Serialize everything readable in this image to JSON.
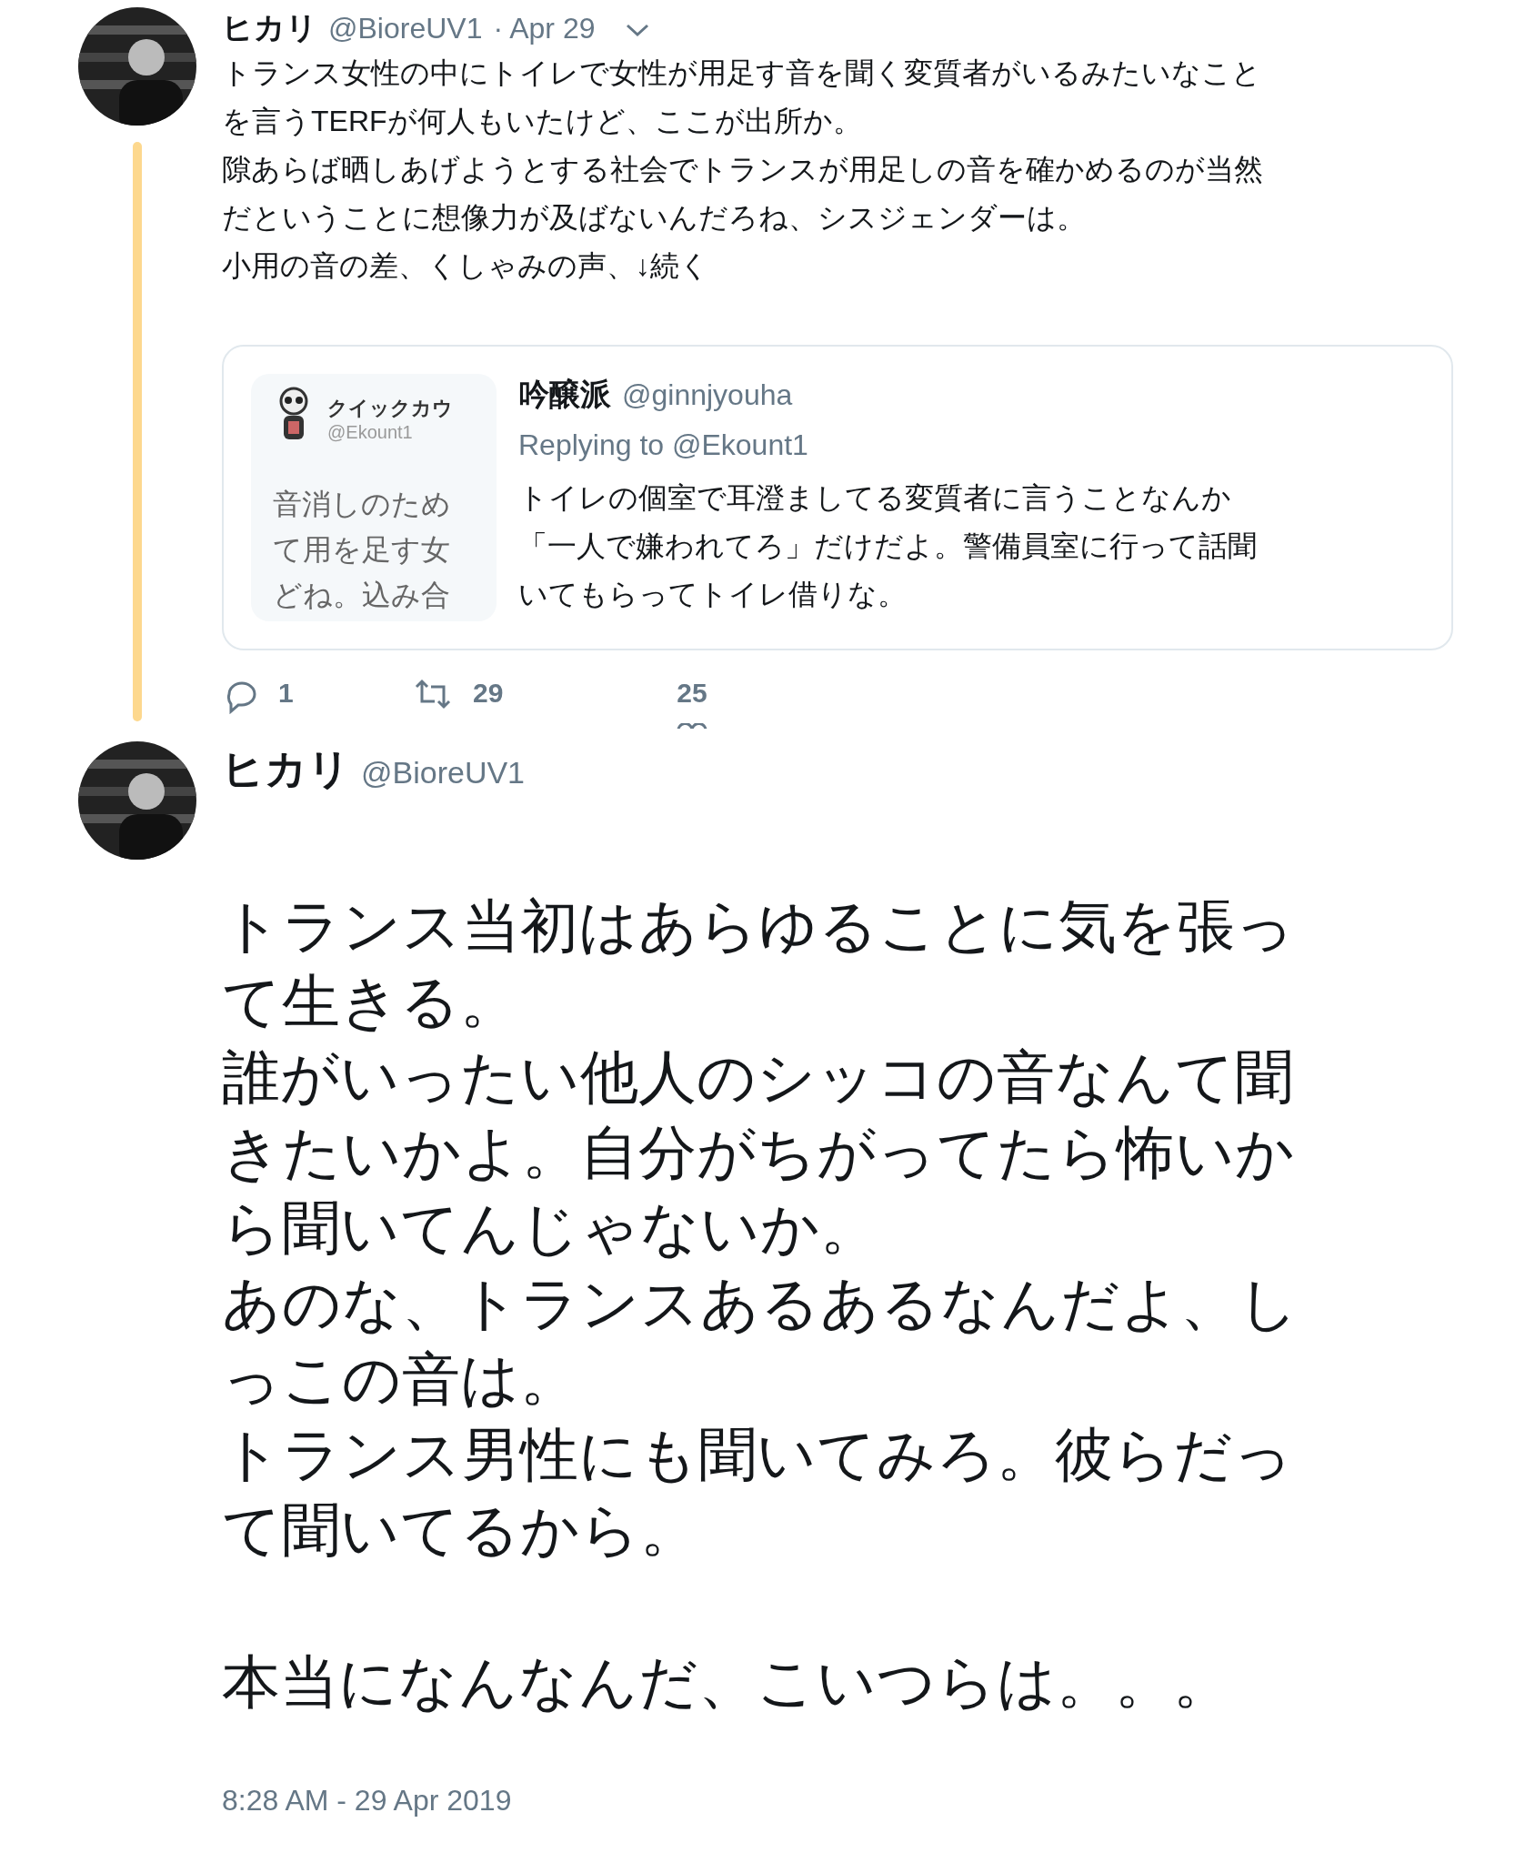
{
  "tweets": [
    {
      "name": "ヒカリ",
      "handle": "@BioreUV1",
      "date": "· Apr 29",
      "lines": [
        "トランス女性の中にトイレで女性が用足す音を聞く変質者がいるみたいなこと",
        "を言うTERFが何人もいたけど、ここが出所か。",
        "隙あらば晒しあげようとする社会でトランスが用足しの音を確かめるのが当然",
        "だということに想像力が及ばないんだろね、シスジェンダーは。",
        "小用の音の差、くしゃみの声、↓続く"
      ],
      "quote": {
        "image": {
          "name": "クイックカウ",
          "handle": "@Ekount1",
          "lines": [
            "音消しのため",
            "て用を足す女",
            "どね。込み合"
          ]
        },
        "name": "吟醸派",
        "handle": "@ginnjyouha",
        "reply": "Replying to @Ekount1",
        "lines": [
          "トイレの個室で耳澄ましてる変質者に言うことなんか",
          "「一人で嫌われてろ」だけだよ。警備員室に行って話聞",
          "いてもらってトイレ借りな。"
        ]
      },
      "actions": [
        {
          "kind": "reply",
          "count": "1"
        },
        {
          "kind": "retweet",
          "count": "29"
        },
        {
          "kind": "like",
          "count": "25"
        }
      ]
    }
  ],
  "main": {
    "name": "ヒカリ",
    "handle": "@BioreUV1",
    "paragraphs": [
      [
        "トランス当初はあらゆることに気を張っ",
        "て生きる。",
        "誰がいったい他人のシッコの音なんて聞",
        "きたいかよ。自分がちがってたら怖いか",
        "ら聞いてんじゃないか。",
        "あのな、トランスあるあるなんだよ、し",
        "っこの音は。",
        "トランス男性にも聞いてみろ。彼らだっ",
        "て聞いてるから。"
      ],
      [
        "本当になんなんだ、こいつらは。。。"
      ]
    ],
    "timestamp": "8:28 AM - 29 Apr 2019"
  }
}
